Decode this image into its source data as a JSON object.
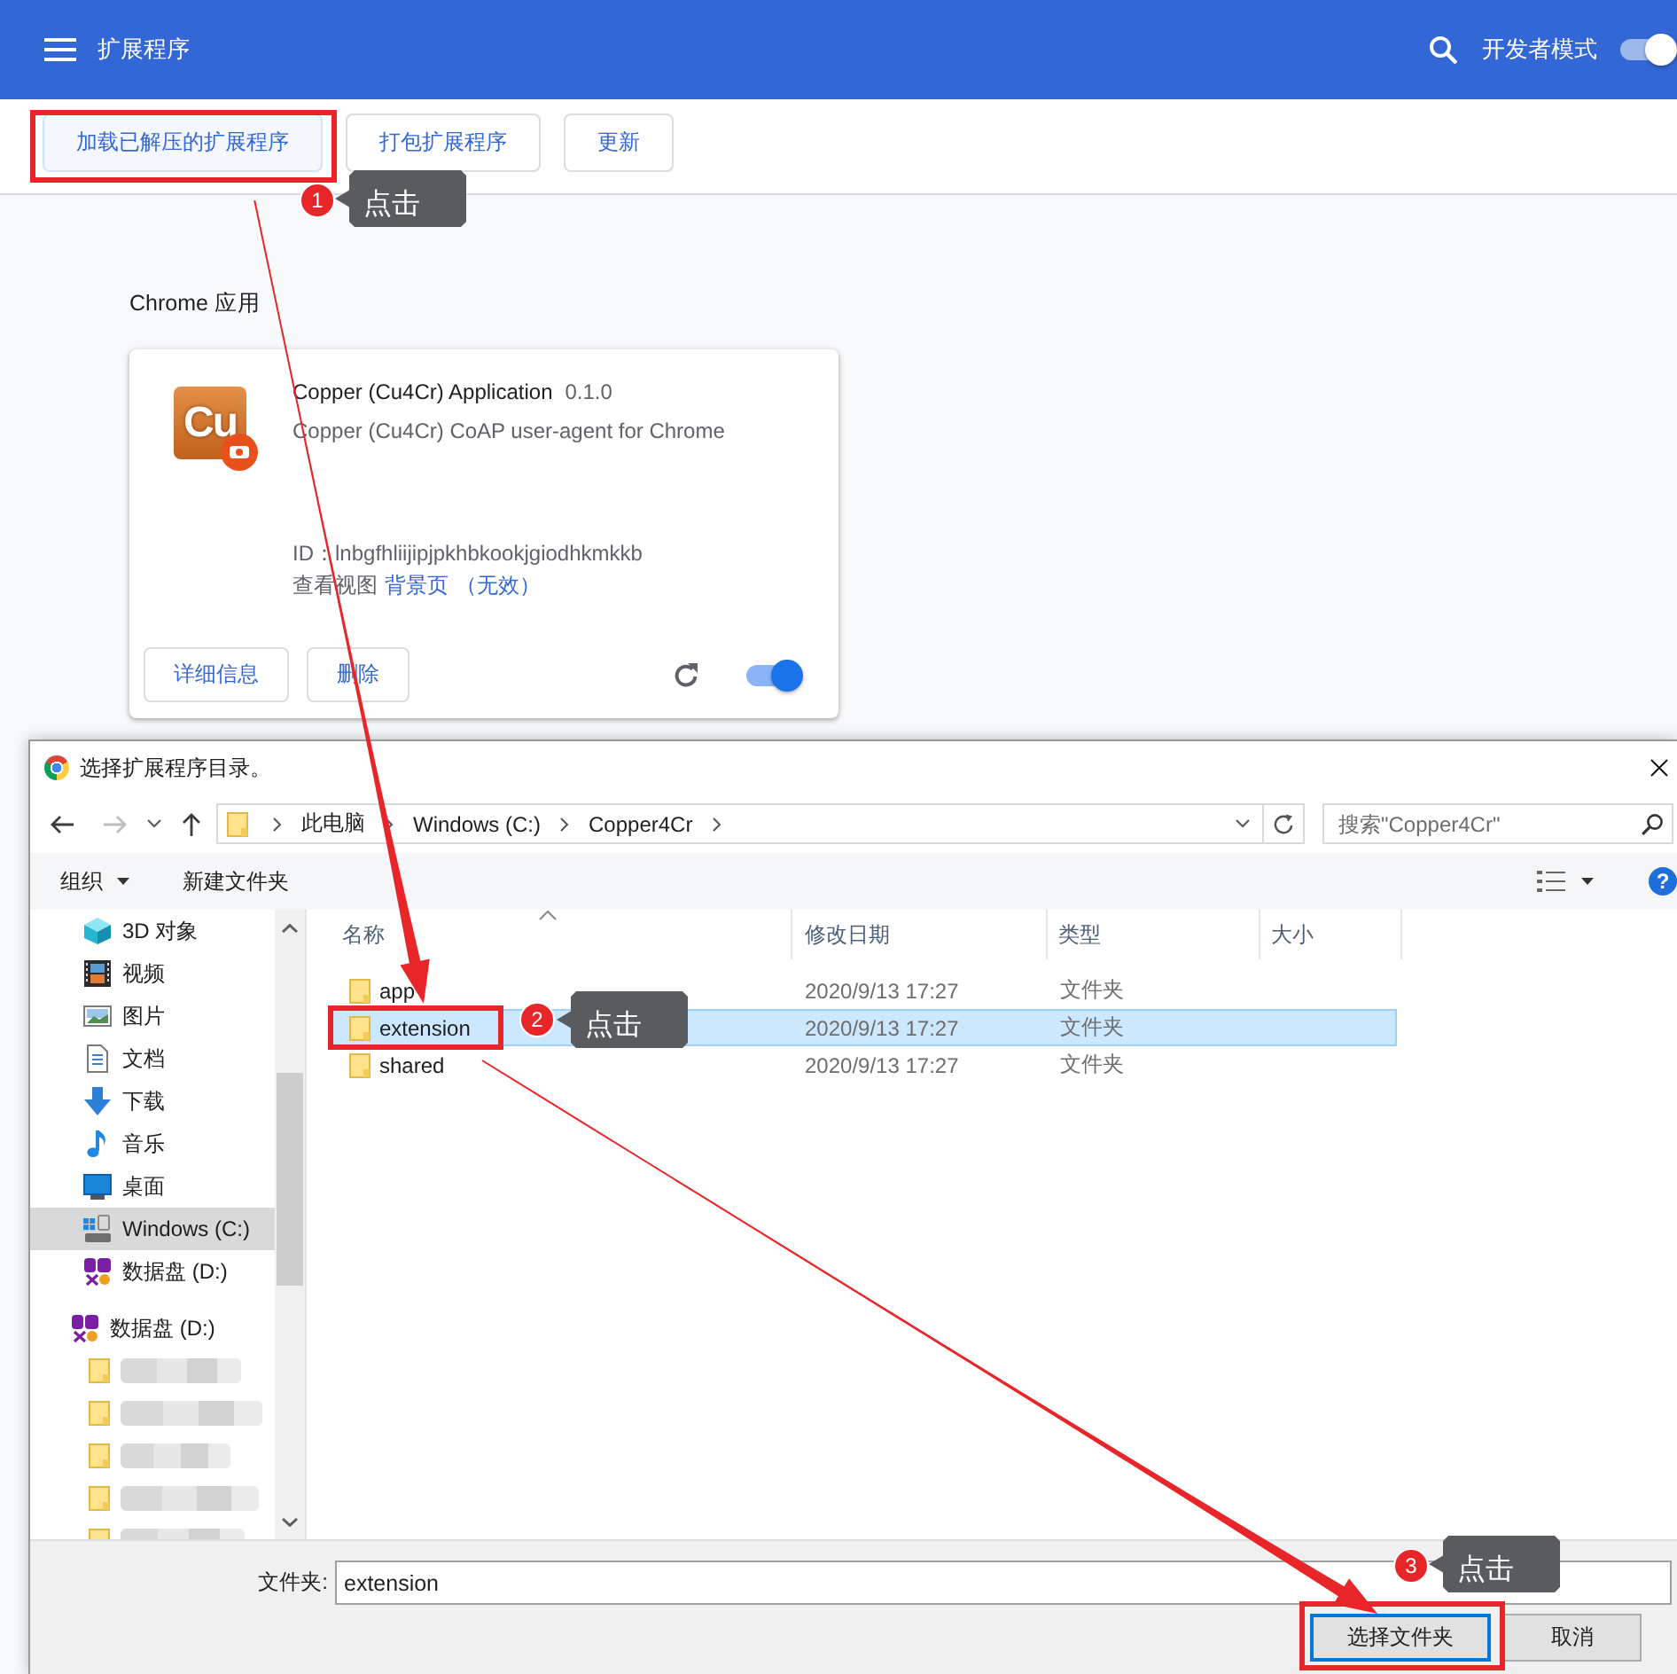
{
  "app_bar": {
    "title": "扩展程序",
    "developer_mode": {
      "label": "开发者模式",
      "on": true
    }
  },
  "toolbar": {
    "buttons": [
      {
        "label": "加载已解压的扩展程序",
        "hovered": true
      },
      {
        "label": "打包扩展程序",
        "hovered": false
      },
      {
        "label": "更新",
        "hovered": false
      }
    ]
  },
  "section_title": "Chrome 应用",
  "extension_card": {
    "logo_text": "Cu",
    "name": "Copper (Cu4Cr) Application",
    "version": "0.1.0",
    "description": "Copper (Cu4Cr) CoAP user-agent for Chrome",
    "id": "ID：lnbgfhliijipjpkhbkookjgiodhkmkkb",
    "views_label": "查看视图",
    "view_link": "背景页",
    "view_status": "（无效）",
    "buttons": [
      "详细信息",
      "删除"
    ],
    "enabled": true
  },
  "dialog": {
    "title": "选择扩展程序目录。",
    "breadcrumb": [
      "此电脑",
      "Windows (C:)",
      "Copper4Cr"
    ],
    "search": {
      "placeholder": "搜索\"Copper4Cr\""
    },
    "commands": [
      {
        "label": "组织",
        "dropdown": true
      },
      {
        "label": "新建文件夹",
        "dropdown": false
      }
    ],
    "help_label": "?",
    "nav": {
      "items": [
        {
          "label": "3D 对象",
          "kind": "objects3d",
          "selected": false
        },
        {
          "label": "视频",
          "kind": "video",
          "selected": false
        },
        {
          "label": "图片",
          "kind": "pictures",
          "selected": false
        },
        {
          "label": "文档",
          "kind": "documents",
          "selected": false
        },
        {
          "label": "下载",
          "kind": "downloads",
          "selected": false
        },
        {
          "label": "音乐",
          "kind": "music",
          "selected": false
        },
        {
          "label": "桌面",
          "kind": "desktop",
          "selected": false
        },
        {
          "label": "Windows (C:)",
          "kind": "drive",
          "selected": true
        },
        {
          "label": "数据盘 (D:)",
          "kind": "sd",
          "selected": false
        }
      ],
      "drive": {
        "label": "数据盘 (D:)",
        "kind": "sd",
        "selected": false,
        "children": [
          {
            "kind": "blurred",
            "selected": false
          },
          {
            "kind": "blurred",
            "selected": false
          },
          {
            "kind": "blurred",
            "selected": false
          },
          {
            "kind": "blurred",
            "selected": false
          },
          {
            "kind": "blurred",
            "selected": false
          }
        ]
      }
    },
    "file_list": {
      "columns": [
        {
          "label": "名称",
          "sorted": true
        },
        {
          "label": "修改日期",
          "sorted": false
        },
        {
          "label": "类型",
          "sorted": false
        },
        {
          "label": "大小",
          "sorted": false
        }
      ],
      "rows": [
        {
          "name": "app",
          "modified": "2020/9/13 17:27",
          "type": "文件夹",
          "selected": false
        },
        {
          "name": "extension",
          "modified": "2020/9/13 17:27",
          "type": "文件夹",
          "selected": true
        },
        {
          "name": "shared",
          "modified": "2020/9/13 17:27",
          "type": "文件夹",
          "selected": false
        }
      ]
    },
    "folder_field": {
      "label": "文件夹:",
      "value": "extension"
    },
    "buttons": [
      {
        "label": "选择文件夹",
        "default": true
      },
      {
        "label": "取消",
        "default": false
      }
    ]
  },
  "annotations": [
    {
      "number": "1",
      "text": "点击"
    },
    {
      "number": "2",
      "text": "点击"
    },
    {
      "number": "3",
      "text": "点击"
    }
  ]
}
